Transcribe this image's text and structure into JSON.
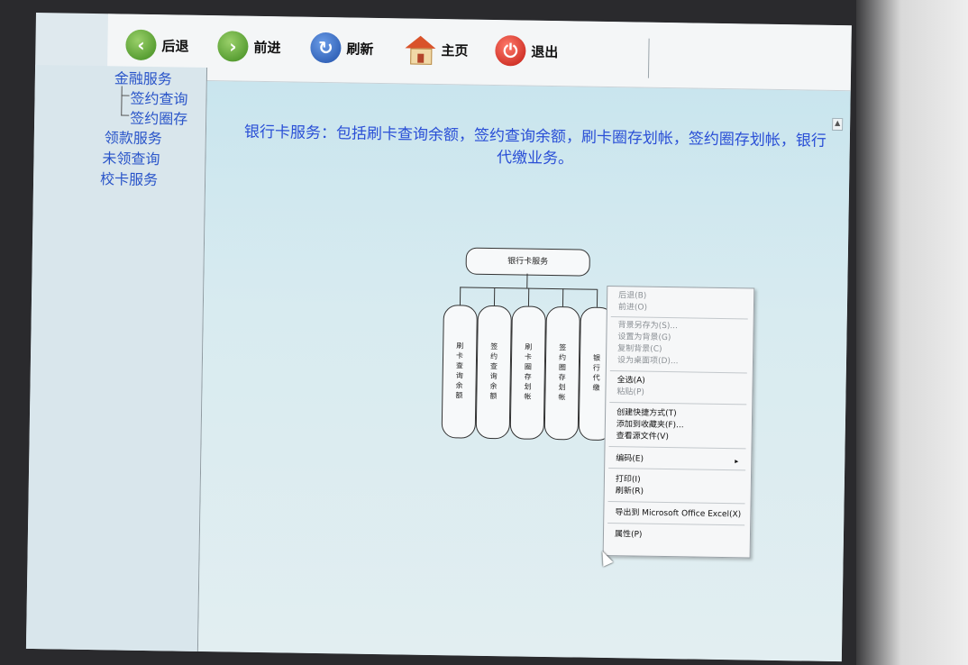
{
  "toolbar": {
    "back": "后退",
    "forward": "前进",
    "refresh": "刷新",
    "home": "主页",
    "exit": "退出"
  },
  "sidebar": {
    "items": [
      {
        "label": "金融服务"
      },
      {
        "label": "签约查询"
      },
      {
        "label": "签约圈存"
      },
      {
        "label": "领款服务"
      },
      {
        "label": "未领查询"
      },
      {
        "label": "校卡服务"
      }
    ]
  },
  "content": {
    "headline": "银行卡服务：包括刷卡查询余额，签约查询余额，刷卡圈存划帐，签约圈存划帐，银行代缴业务。",
    "diagram": {
      "root": "银行卡服务",
      "children": [
        "刷卡查询余额",
        "签约查询余额",
        "刷卡圈存划帐",
        "签约圈存划帐",
        "银行代缴"
      ]
    }
  },
  "context_menu": {
    "items": [
      {
        "label": "后退(B)",
        "enabled": false
      },
      {
        "label": "前进(O)",
        "enabled": false
      },
      {
        "label": "背景另存为(S)...",
        "enabled": false
      },
      {
        "label": "设置为背景(G)",
        "enabled": false
      },
      {
        "label": "复制背景(C)",
        "enabled": false
      },
      {
        "label": "设为桌面项(D)...",
        "enabled": false
      },
      {
        "label": "全选(A)",
        "enabled": true
      },
      {
        "label": "粘贴(P)",
        "enabled": false
      },
      {
        "label": "创建快捷方式(T)",
        "enabled": true
      },
      {
        "label": "添加到收藏夹(F)...",
        "enabled": true
      },
      {
        "label": "查看源文件(V)",
        "enabled": true
      },
      {
        "label": "编码(E)",
        "enabled": true
      },
      {
        "label": "打印(I)",
        "enabled": true
      },
      {
        "label": "刷新(R)",
        "enabled": true
      },
      {
        "label": "导出到 Microsoft Office Excel(X)",
        "enabled": true
      },
      {
        "label": "属性(P)",
        "enabled": true
      }
    ]
  }
}
